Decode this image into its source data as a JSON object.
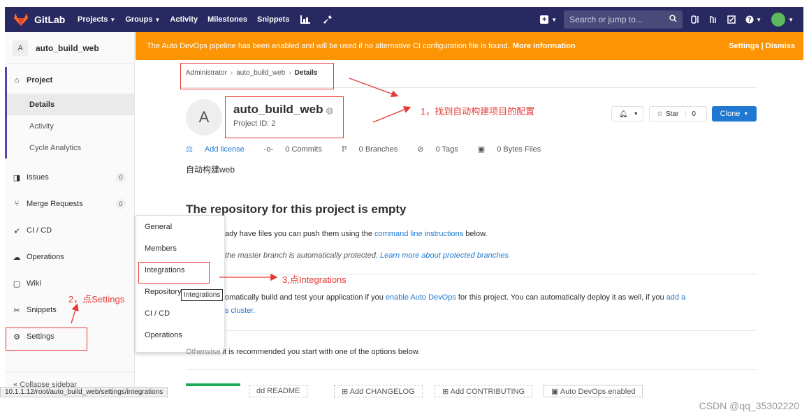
{
  "navbar": {
    "brand": "GitLab",
    "projects": "Projects",
    "groups": "Groups",
    "activity": "Activity",
    "milestones": "Milestones",
    "snippets": "Snippets",
    "search_placeholder": "Search or jump to..."
  },
  "sidebar": {
    "project_initial": "A",
    "project_name": "auto_build_web",
    "project_label": "Project",
    "sub_items": [
      "Details",
      "Activity",
      "Cycle Analytics"
    ],
    "issues": "Issues",
    "issues_count": "0",
    "merge_requests": "Merge Requests",
    "mr_count": "0",
    "cicd": "CI / CD",
    "operations": "Operations",
    "wiki": "Wiki",
    "snippets": "Snippets",
    "settings": "Settings",
    "collapse": "Collapse sidebar"
  },
  "flyout": {
    "items": [
      "General",
      "Members",
      "Integrations",
      "Repository",
      "CI / CD",
      "Operations"
    ],
    "tooltip": "Integrations"
  },
  "banner": {
    "text": "The Auto DevOps pipeline has been enabled and will be used if no alternative CI configuration file is found.",
    "more": "More information",
    "right": "Settings | Dismiss"
  },
  "breadcrumb": [
    "Administrator",
    "auto_build_web",
    "Details"
  ],
  "project": {
    "initial": "A",
    "title": "auto_build_web",
    "id": "Project ID: 2",
    "description": "自动构建web",
    "star_label": "Star",
    "star_count": "0",
    "clone_label": "Clone"
  },
  "stats": {
    "add_license": "Add license",
    "commits": "0 Commits",
    "branches": "0 Branches",
    "tags": "0 Tags",
    "files": "0 Bytes Files"
  },
  "empty": {
    "title": "The repository for this project is empty",
    "line1_pre": "ady have files you can push them using the",
    "line1_link": "command line instructions",
    "line1_post": "below.",
    "line2_pre": "the master branch is automatically protected.",
    "line2_link": "Learn more about protected branches",
    "line3_pre": "omatically build and test your application if you",
    "line3_link": "enable Auto DevOps",
    "line3_post": "for this project. You can automatically deploy it as well, if you",
    "line3_link2": "add a",
    "line4_link": "s cluster.",
    "line5": "it is recommended you start with one of the options below.",
    "line5_partial": "Otherwise"
  },
  "bottom_buttons": [
    "dd README",
    "Add CHANGELOG",
    "Add CONTRIBUTING",
    "Auto DevOps enabled"
  ],
  "annotations": {
    "a1": "1，找到自动构建项目的配置",
    "a2": "2，点Settings",
    "a3": "3,点Integrations"
  },
  "statusbar": "10.1.1.12/root/auto_build_web/settings/integrations",
  "watermark": "CSDN @qq_35302220",
  "colors": {
    "navbar": "#292961",
    "banner": "#fc9403",
    "link": "#1f78d1",
    "annotation": "#e53935"
  }
}
